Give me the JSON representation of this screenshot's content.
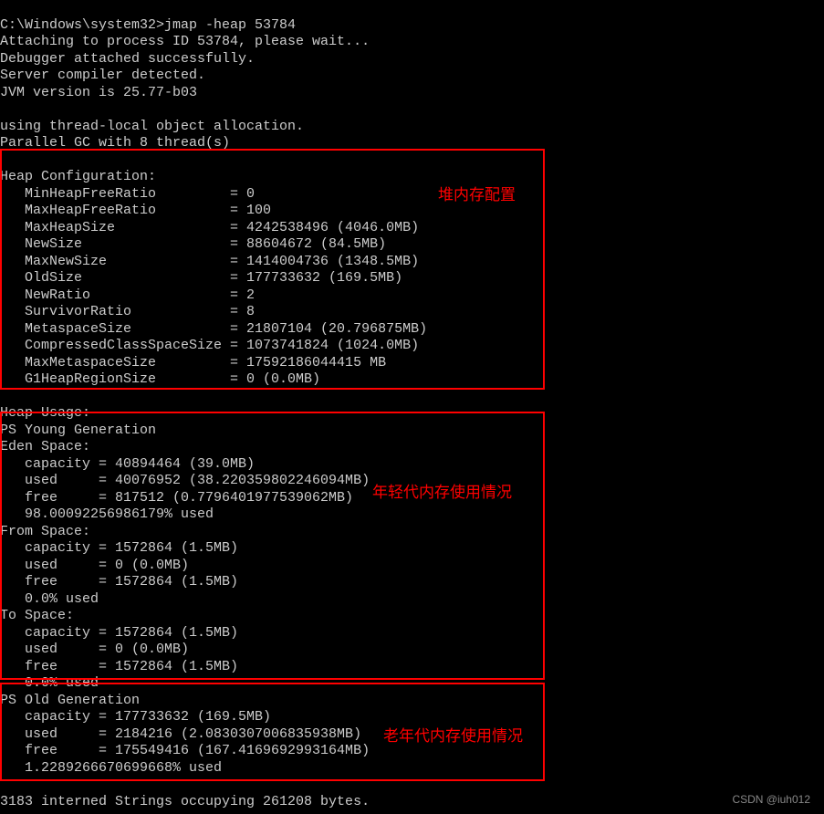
{
  "terminal": {
    "prompt": "C:\\Windows\\system32>",
    "command": "jmap -heap 53784",
    "lines": [
      "Attaching to process ID 53784, please wait...",
      "Debugger attached successfully.",
      "Server compiler detected.",
      "JVM version is 25.77-b03",
      "",
      "using thread-local object allocation.",
      "Parallel GC with 8 thread(s)",
      "",
      "Heap Configuration:",
      "   MinHeapFreeRatio         = 0",
      "   MaxHeapFreeRatio         = 100",
      "   MaxHeapSize              = 4242538496 (4046.0MB)",
      "   NewSize                  = 88604672 (84.5MB)",
      "   MaxNewSize               = 1414004736 (1348.5MB)",
      "   OldSize                  = 177733632 (169.5MB)",
      "   NewRatio                 = 2",
      "   SurvivorRatio            = 8",
      "   MetaspaceSize            = 21807104 (20.796875MB)",
      "   CompressedClassSpaceSize = 1073741824 (1024.0MB)",
      "   MaxMetaspaceSize         = 17592186044415 MB",
      "   G1HeapRegionSize         = 0 (0.0MB)",
      "",
      "Heap Usage:",
      "PS Young Generation",
      "Eden Space:",
      "   capacity = 40894464 (39.0MB)",
      "   used     = 40076952 (38.220359802246094MB)",
      "   free     = 817512 (0.7796401977539062MB)",
      "   98.00092256986179% used",
      "From Space:",
      "   capacity = 1572864 (1.5MB)",
      "   used     = 0 (0.0MB)",
      "   free     = 1572864 (1.5MB)",
      "   0.0% used",
      "To Space:",
      "   capacity = 1572864 (1.5MB)",
      "   used     = 0 (0.0MB)",
      "   free     = 1572864 (1.5MB)",
      "   0.0% used",
      "PS Old Generation",
      "   capacity = 177733632 (169.5MB)",
      "   used     = 2184216 (2.0830307006835938MB)",
      "   free     = 175549416 (167.4169692993164MB)",
      "   1.2289266670699668% used",
      "",
      "3183 interned Strings occupying 261208 bytes."
    ]
  },
  "annotations": {
    "heap_config": "堆内存配置",
    "young_gen": "年轻代内存使用情况",
    "old_gen": "老年代内存使用情况"
  },
  "watermark": "CSDN @iuh012"
}
